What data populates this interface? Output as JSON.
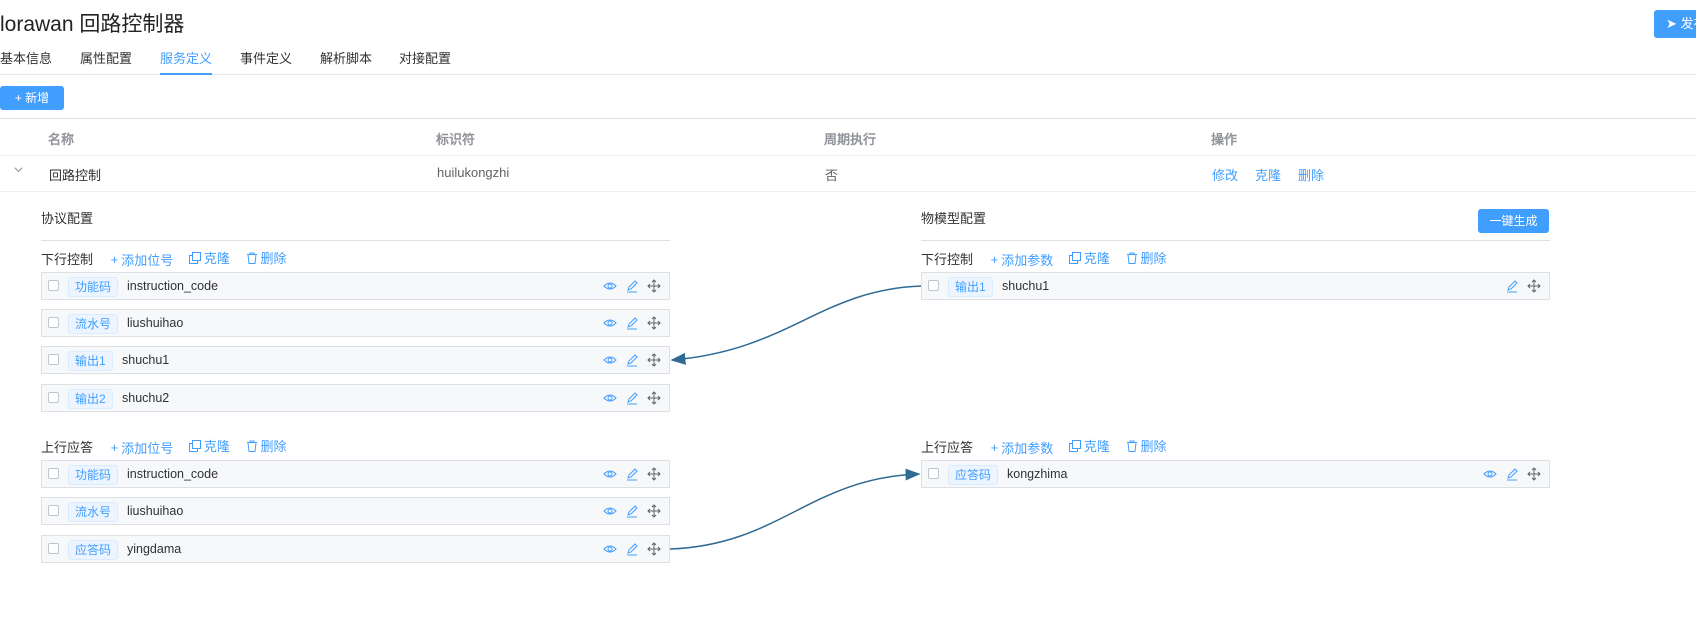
{
  "header": {
    "title": "lorawan 回路控制器",
    "publish_label": "发布"
  },
  "tabs": [
    "基本信息",
    "属性配置",
    "服务定义",
    "事件定义",
    "解析脚本",
    "对接配置"
  ],
  "active_tab": "服务定义",
  "toolbar": {
    "add_label": "+ 新增"
  },
  "table": {
    "columns": [
      "名称",
      "标识符",
      "周期执行",
      "操作"
    ],
    "row": {
      "name": "回路控制",
      "identifier": "huilukongzhi",
      "periodic": "否",
      "actions": [
        "修改",
        "克隆",
        "删除"
      ]
    }
  },
  "protocol": {
    "title": "协议配置",
    "down": {
      "label": "下行控制",
      "add": "添加位号",
      "clone": "克隆",
      "delete": "删除",
      "fields": [
        {
          "tag": "功能码",
          "name": "instruction_code"
        },
        {
          "tag": "流水号",
          "name": "liushuihao"
        },
        {
          "tag": "输出1",
          "name": "shuchu1"
        },
        {
          "tag": "输出2",
          "name": "shuchu2"
        }
      ]
    },
    "up": {
      "label": "上行应答",
      "add": "添加位号",
      "clone": "克隆",
      "delete": "删除",
      "fields": [
        {
          "tag": "功能码",
          "name": "instruction_code"
        },
        {
          "tag": "流水号",
          "name": "liushuihao"
        },
        {
          "tag": "应答码",
          "name": "yingdama"
        }
      ]
    }
  },
  "model": {
    "title": "物模型配置",
    "generate_label": "一键生成",
    "down": {
      "label": "下行控制",
      "add": "添加参数",
      "clone": "克隆",
      "delete": "删除",
      "fields": [
        {
          "tag": "输出1",
          "name": "shuchu1"
        }
      ]
    },
    "up": {
      "label": "上行应答",
      "add": "添加参数",
      "clone": "克隆",
      "delete": "删除",
      "fields": [
        {
          "tag": "应答码",
          "name": "kongzhima"
        }
      ]
    }
  },
  "colors": {
    "accent": "#409eff",
    "connector": "#2e6a94",
    "border": "#dcdfe6"
  }
}
